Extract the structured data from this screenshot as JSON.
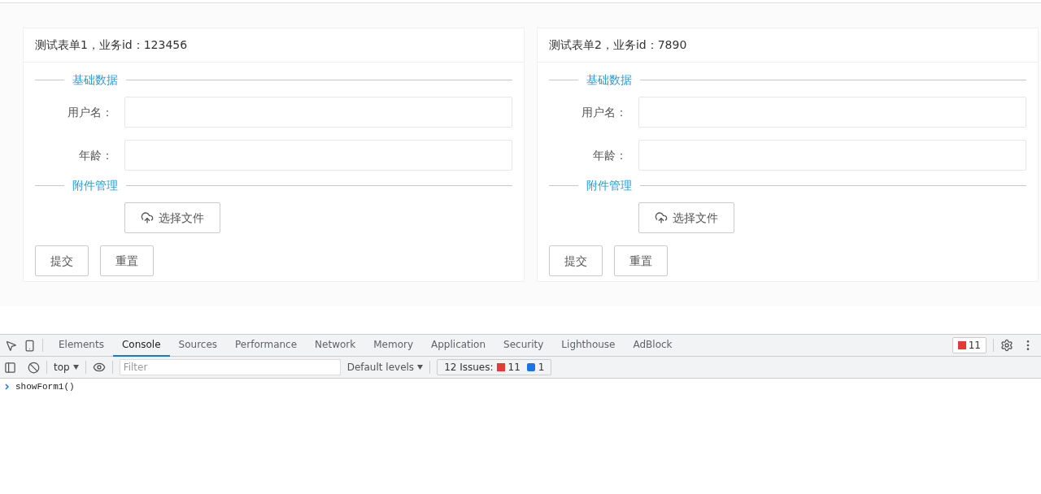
{
  "forms": [
    {
      "title": "测试表单1，业务id：123456",
      "sections": [
        {
          "title": "基础数据",
          "fields": [
            {
              "label": "用户名："
            },
            {
              "label": "年龄："
            }
          ]
        },
        {
          "title": "附件管理",
          "upload": "选择文件"
        }
      ],
      "buttons": [
        "提交",
        "重置"
      ]
    },
    {
      "title": "测试表单2，业务id：7890",
      "sections": [
        {
          "title": "基础数据",
          "fields": [
            {
              "label": "用户名："
            },
            {
              "label": "年龄："
            }
          ]
        },
        {
          "title": "附件管理",
          "upload": "选择文件"
        }
      ],
      "buttons": [
        "提交",
        "重置"
      ]
    }
  ],
  "devtools": {
    "tabs": [
      {
        "label": "Elements",
        "selected": false
      },
      {
        "label": "Console",
        "selected": true
      },
      {
        "label": "Sources",
        "selected": false
      },
      {
        "label": "Performance",
        "selected": false
      },
      {
        "label": "Network",
        "selected": false
      },
      {
        "label": "Memory",
        "selected": false
      },
      {
        "label": "Application",
        "selected": false
      },
      {
        "label": "Security",
        "selected": false
      },
      {
        "label": "Lighthouse",
        "selected": false
      },
      {
        "label": "AdBlock",
        "selected": false
      }
    ],
    "error_count": "11",
    "context": "top",
    "filter": {
      "placeholder": "Filter"
    },
    "levels": "Default levels",
    "issues": {
      "label": "12 Issues:",
      "errors": "11",
      "messages": "1"
    },
    "console_lines": [
      "showForm1()"
    ]
  }
}
